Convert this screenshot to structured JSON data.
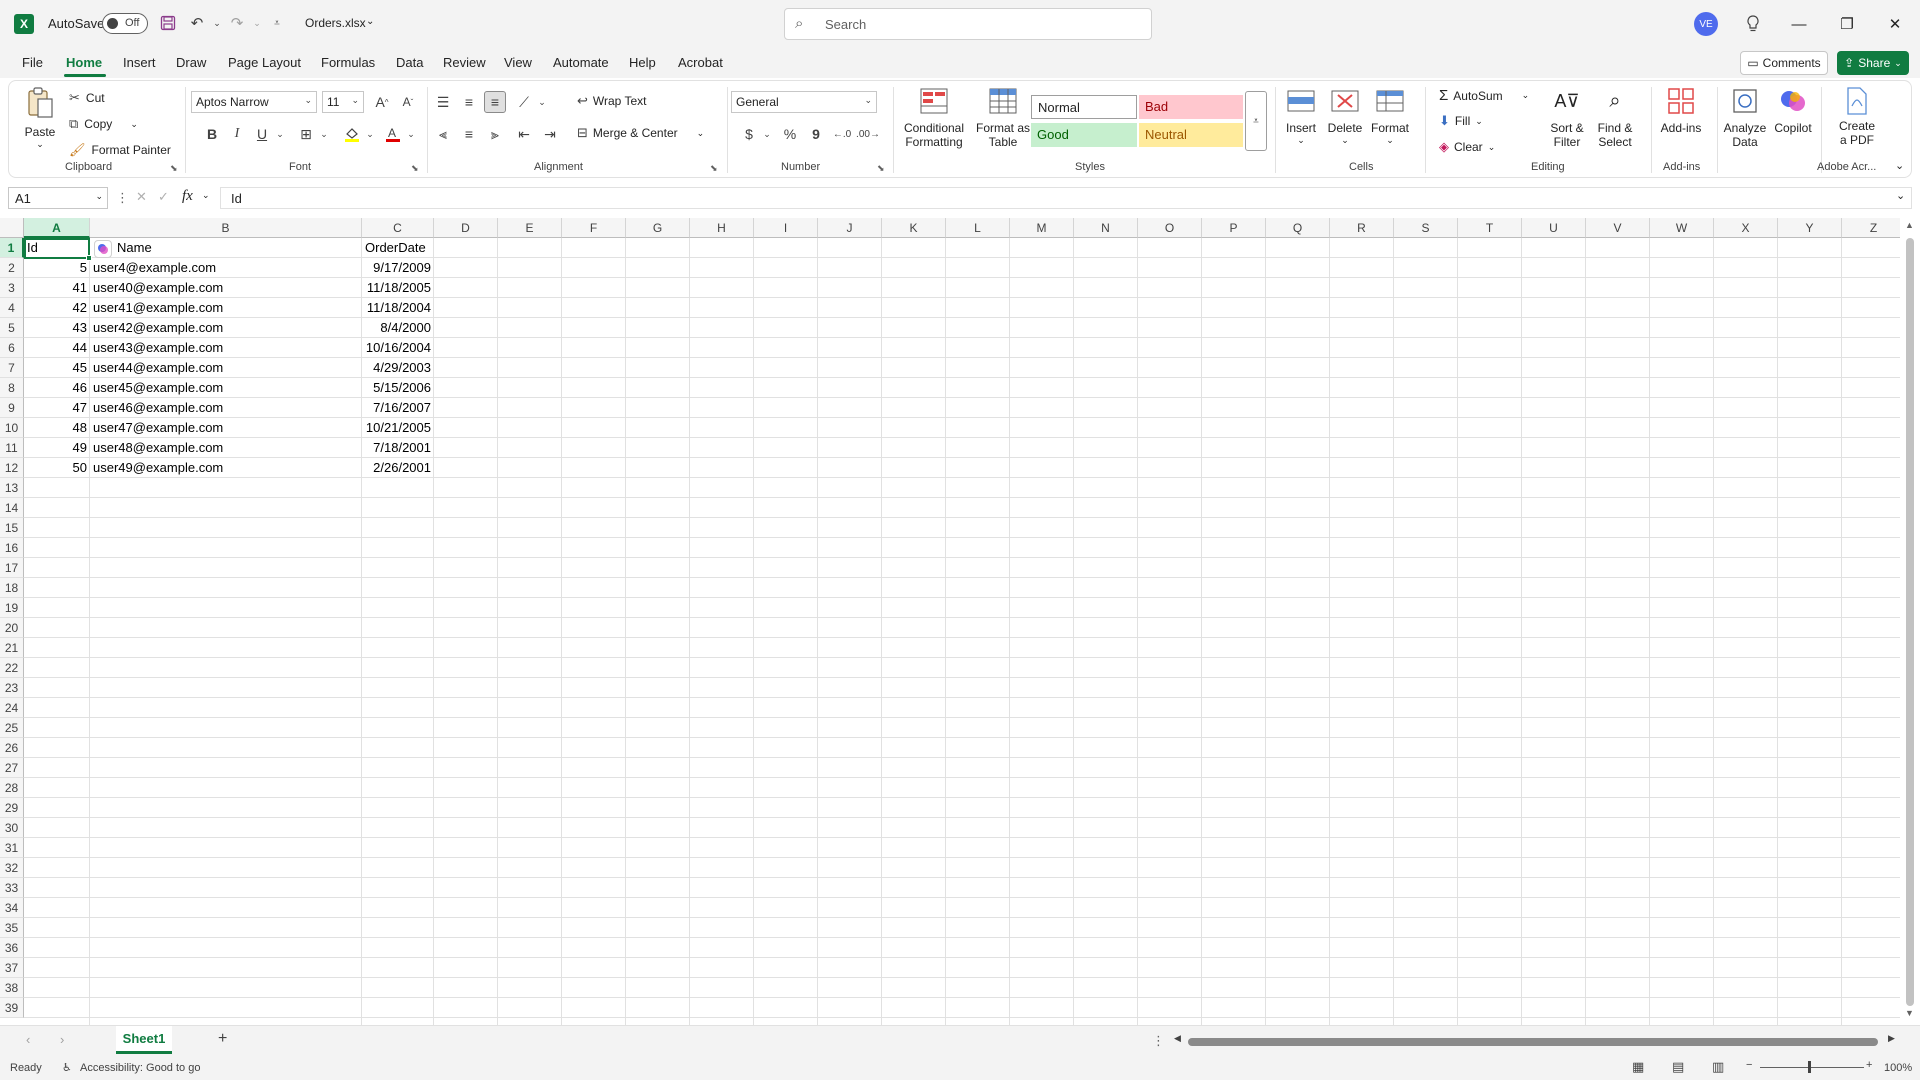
{
  "titlebar": {
    "autosave_label": "AutoSave",
    "autosave_state": "Off",
    "filename": "Orders.xlsx",
    "search_placeholder": "Search",
    "user_initials": "VE"
  },
  "menu": {
    "tabs": [
      "File",
      "Home",
      "Insert",
      "Draw",
      "Page Layout",
      "Formulas",
      "Data",
      "Review",
      "View",
      "Automate",
      "Help",
      "Acrobat"
    ],
    "comments_label": "Comments",
    "share_label": "Share"
  },
  "ribbon": {
    "clipboard": {
      "paste": "Paste",
      "cut": "Cut",
      "copy": "Copy",
      "format_painter": "Format Painter",
      "label": "Clipboard"
    },
    "font": {
      "name": "Aptos Narrow",
      "size": "11",
      "bold": "B",
      "italic": "I",
      "underline": "U",
      "label": "Font"
    },
    "alignment": {
      "wrap_text": "Wrap Text",
      "merge_center": "Merge & Center",
      "label": "Alignment"
    },
    "number": {
      "format": "General",
      "currency": "$",
      "percent": "%",
      "comma": "9",
      "label": "Number"
    },
    "styles": {
      "conditional": "Conditional",
      "conditional2": "Formatting",
      "format_as": "Format as",
      "format_as2": "Table",
      "normal": "Normal",
      "bad": "Bad",
      "good": "Good",
      "neutral": "Neutral",
      "label": "Styles"
    },
    "cells": {
      "insert": "Insert",
      "delete": "Delete",
      "format": "Format",
      "label": "Cells"
    },
    "editing": {
      "autosum": "AutoSum",
      "fill": "Fill",
      "clear": "Clear",
      "sort": "Sort &",
      "sort2": "Filter",
      "find": "Find &",
      "find2": "Select",
      "label": "Editing"
    },
    "addins": {
      "addins": "Add-ins",
      "label": "Add-ins"
    },
    "analyze": {
      "line1": "Analyze",
      "line2": "Data"
    },
    "copilot": "Copilot",
    "pdf": {
      "line1": "Create",
      "line2": "a PDF",
      "label": "Adobe Acr..."
    }
  },
  "formula_bar": {
    "name_box": "A1",
    "fx": "fx",
    "content": "Id"
  },
  "columns": [
    "A",
    "B",
    "C",
    "D",
    "E",
    "F",
    "G",
    "H",
    "I",
    "J",
    "K",
    "L",
    "M",
    "N",
    "O",
    "P",
    "Q",
    "R",
    "S",
    "T",
    "U",
    "V",
    "W",
    "X",
    "Y",
    "Z"
  ],
  "headers": {
    "a": "Id",
    "b": "Name",
    "c": "OrderDate"
  },
  "rows": [
    {
      "id": "5",
      "name": "user4@example.com",
      "date": "9/17/2009"
    },
    {
      "id": "41",
      "name": "user40@example.com",
      "date": "11/18/2005"
    },
    {
      "id": "42",
      "name": "user41@example.com",
      "date": "11/18/2004"
    },
    {
      "id": "43",
      "name": "user42@example.com",
      "date": "8/4/2000"
    },
    {
      "id": "44",
      "name": "user43@example.com",
      "date": "10/16/2004"
    },
    {
      "id": "45",
      "name": "user44@example.com",
      "date": "4/29/2003"
    },
    {
      "id": "46",
      "name": "user45@example.com",
      "date": "5/15/2006"
    },
    {
      "id": "47",
      "name": "user46@example.com",
      "date": "7/16/2007"
    },
    {
      "id": "48",
      "name": "user47@example.com",
      "date": "10/21/2005"
    },
    {
      "id": "49",
      "name": "user48@example.com",
      "date": "7/18/2001"
    },
    {
      "id": "50",
      "name": "user49@example.com",
      "date": "2/26/2001"
    }
  ],
  "row_numbers": [
    "1",
    "2",
    "3",
    "4",
    "5",
    "6",
    "7",
    "8",
    "9",
    "10",
    "11",
    "12",
    "13",
    "14",
    "15",
    "16",
    "17",
    "18",
    "19",
    "20",
    "21",
    "22",
    "23",
    "24",
    "25",
    "26",
    "27",
    "28",
    "29",
    "30",
    "31",
    "32",
    "33",
    "34",
    "35",
    "36",
    "37",
    "38",
    "39"
  ],
  "sheet": {
    "name": "Sheet1",
    "add": "+"
  },
  "status": {
    "ready": "Ready",
    "accessibility": "Accessibility: Good to go",
    "zoom": "100%"
  },
  "colors": {
    "accent": "#107c41",
    "bad_bg": "#ffc7ce",
    "bad_fg": "#9c0006",
    "good_bg": "#c6efce",
    "good_fg": "#006100",
    "neutral_bg": "#ffeb9c",
    "neutral_fg": "#9c5700"
  }
}
